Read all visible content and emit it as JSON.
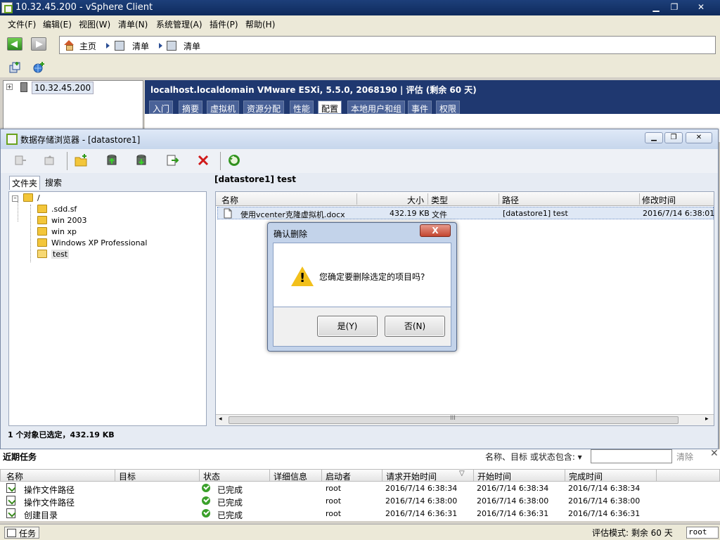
{
  "window": {
    "title": "10.32.45.200 - vSphere Client",
    "minimize": "▁",
    "maximize": "❐",
    "close": "✕"
  },
  "menubar": {
    "items": [
      "文件(F)",
      "编辑(E)",
      "视图(W)",
      "清单(N)",
      "系统管理(A)",
      "插件(P)",
      "帮助(H)"
    ]
  },
  "nav": {
    "breadcrumbs": [
      "主页",
      "清单",
      "清单"
    ]
  },
  "inventory": {
    "host_label": "10.32.45.200",
    "expander": "+"
  },
  "host": {
    "header": "localhost.localdomain VMware ESXi, 5.5.0, 2068190 | 评估 (剩余 60 天)",
    "tabs": [
      "入门",
      "摘要",
      "虚拟机",
      "资源分配",
      "性能",
      "配置",
      "本地用户和组",
      "事件",
      "权限"
    ],
    "active_tab": "配置"
  },
  "datastore_browser": {
    "title": "数据存储浏览器 - [datastore1]",
    "left_tabs": [
      "文件夹",
      "搜索"
    ],
    "tree": {
      "root": "/",
      "children": [
        ".sdd.sf",
        "win 2003",
        "win xp",
        "Windows XP Professional",
        "test"
      ],
      "selected": "test"
    },
    "path": "[datastore1] test",
    "columns": [
      "名称",
      "大小",
      "类型",
      "路径",
      "修改时间"
    ],
    "files": [
      {
        "name": "使用vcenter克隆虚拟机.docx",
        "size": "432.19 KB",
        "type": "文件",
        "path": "[datastore1] test",
        "modified": "2016/7/14 6:38:01"
      }
    ],
    "scroll_grip": "III",
    "status": "1 个对象已选定，432.19 KB"
  },
  "dialog": {
    "title": "确认删除",
    "close": "X",
    "warn_glyph": "!",
    "message": "您确定要删除选定的项目吗?",
    "yes": "是(Y)",
    "no": "否(N)"
  },
  "tasks": {
    "title": "近期任务",
    "filter_label": "名称、目标 或状态包含: ▾",
    "clear": "清除",
    "close": "✕",
    "columns": [
      "名称",
      "目标",
      "状态",
      "详细信息",
      "启动者",
      "请求开始时间",
      "开始时间",
      "完成时间"
    ],
    "sort_glyph": "▽",
    "rows": [
      {
        "name": "操作文件路径",
        "target": "",
        "status": "已完成",
        "details": "",
        "initiator": "root",
        "requested": "2016/7/14 6:38:34",
        "start": "2016/7/14 6:38:34",
        "end": "2016/7/14 6:38:34"
      },
      {
        "name": "操作文件路径",
        "target": "",
        "status": "已完成",
        "details": "",
        "initiator": "root",
        "requested": "2016/7/14 6:38:00",
        "start": "2016/7/14 6:38:00",
        "end": "2016/7/14 6:38:00"
      },
      {
        "name": "创建目录",
        "target": "",
        "status": "已完成",
        "details": "",
        "initiator": "root",
        "requested": "2016/7/14 6:36:31",
        "start": "2016/7/14 6:36:31",
        "end": "2016/7/14 6:36:31"
      }
    ]
  },
  "statusbar": {
    "tasks_button": "任务",
    "eval_mode": "评估模式: 剩余 60 天",
    "user": "root"
  },
  "colors": {
    "title_bar": "#1d3f7a",
    "host_header": "#1f3870",
    "success": "#3aa02a",
    "delete_red": "#d01a1a"
  }
}
